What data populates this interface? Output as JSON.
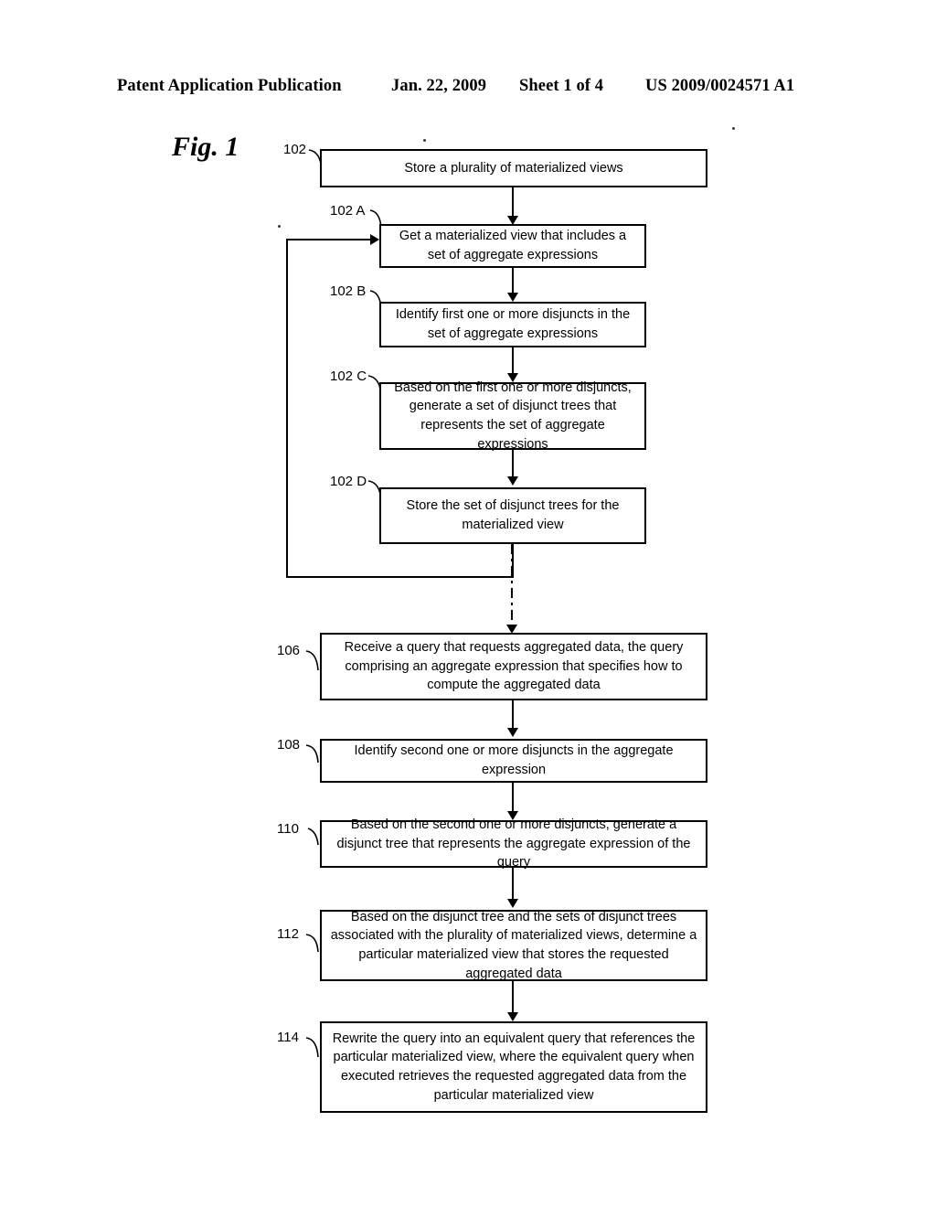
{
  "header": {
    "publication": "Patent Application Publication",
    "date": "Jan. 22, 2009",
    "sheet": "Sheet 1 of 4",
    "number": "US 2009/0024571 A1"
  },
  "figure": {
    "label": "Fig. 1"
  },
  "flowchart": {
    "steps": [
      {
        "ref": "102",
        "text": "Store a plurality of materialized views"
      },
      {
        "ref": "102 A",
        "text": "Get a materialized view that includes a set of aggregate expressions"
      },
      {
        "ref": "102 B",
        "text": "Identify first one or more disjuncts in the set of aggregate expressions"
      },
      {
        "ref": "102 C",
        "text": "Based on the first one or more disjuncts, generate a set of disjunct trees that represents the set of aggregate expressions"
      },
      {
        "ref": "102 D",
        "text": "Store the set of disjunct trees for the materialized view"
      },
      {
        "ref": "106",
        "text": "Receive a query that requests aggregated data, the query comprising an aggregate expression that specifies how to compute the aggregated data"
      },
      {
        "ref": "108",
        "text": "Identify second one or more disjuncts in the aggregate expression"
      },
      {
        "ref": "110",
        "text": "Based on the second one or more disjuncts, generate a disjunct tree that represents the aggregate expression of the query"
      },
      {
        "ref": "112",
        "text": "Based on the disjunct tree and the sets of disjunct trees associated with the plurality of materialized views, determine a particular materialized view that stores the requested aggregated data"
      },
      {
        "ref": "114",
        "text": "Rewrite the query into an equivalent query that references the particular materialized view, where the equivalent query when executed retrieves the requested aggregated data from the particular materialized view"
      }
    ]
  }
}
